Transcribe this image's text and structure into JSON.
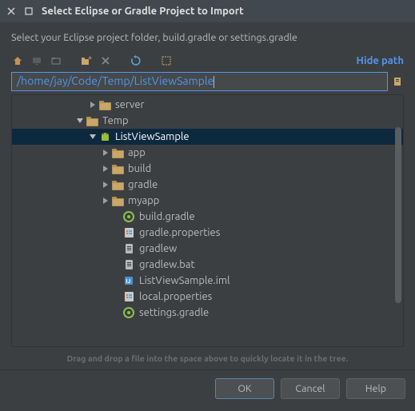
{
  "window": {
    "title": "Select Eclipse or Gradle Project to Import",
    "instruction": "Select your Eclipse project folder, build.gradle or settings.gradle"
  },
  "toolbar": {
    "hide_path": "Hide path"
  },
  "path": "/home/jay/Code/Temp/ListViewSample",
  "tree": [
    {
      "indent": 88,
      "arrow": "right",
      "icon": "folder",
      "label": "server"
    },
    {
      "indent": 72,
      "arrow": "down",
      "icon": "folder",
      "label": "Temp"
    },
    {
      "indent": 88,
      "arrow": "down",
      "icon": "android",
      "label": "ListViewSample",
      "selected": true
    },
    {
      "indent": 104,
      "arrow": "right",
      "icon": "folder",
      "label": "app"
    },
    {
      "indent": 104,
      "arrow": "right",
      "icon": "folder",
      "label": "build"
    },
    {
      "indent": 104,
      "arrow": "right",
      "icon": "folder",
      "label": "gradle"
    },
    {
      "indent": 104,
      "arrow": "right",
      "icon": "folder",
      "label": "myapp"
    },
    {
      "indent": 118,
      "arrow": "none",
      "icon": "gradle",
      "label": "build.gradle"
    },
    {
      "indent": 118,
      "arrow": "none",
      "icon": "properties",
      "label": "gradle.properties"
    },
    {
      "indent": 118,
      "arrow": "none",
      "icon": "file",
      "label": "gradlew"
    },
    {
      "indent": 118,
      "arrow": "none",
      "icon": "file",
      "label": "gradlew.bat"
    },
    {
      "indent": 118,
      "arrow": "none",
      "icon": "iml",
      "label": "ListViewSample.iml"
    },
    {
      "indent": 118,
      "arrow": "none",
      "icon": "properties",
      "label": "local.properties"
    },
    {
      "indent": 118,
      "arrow": "none",
      "icon": "gradle",
      "label": "settings.gradle"
    }
  ],
  "hint": "Drag and drop a file into the space above to quickly locate it in the tree.",
  "buttons": {
    "ok": "OK",
    "cancel": "Cancel",
    "help": "Help"
  }
}
